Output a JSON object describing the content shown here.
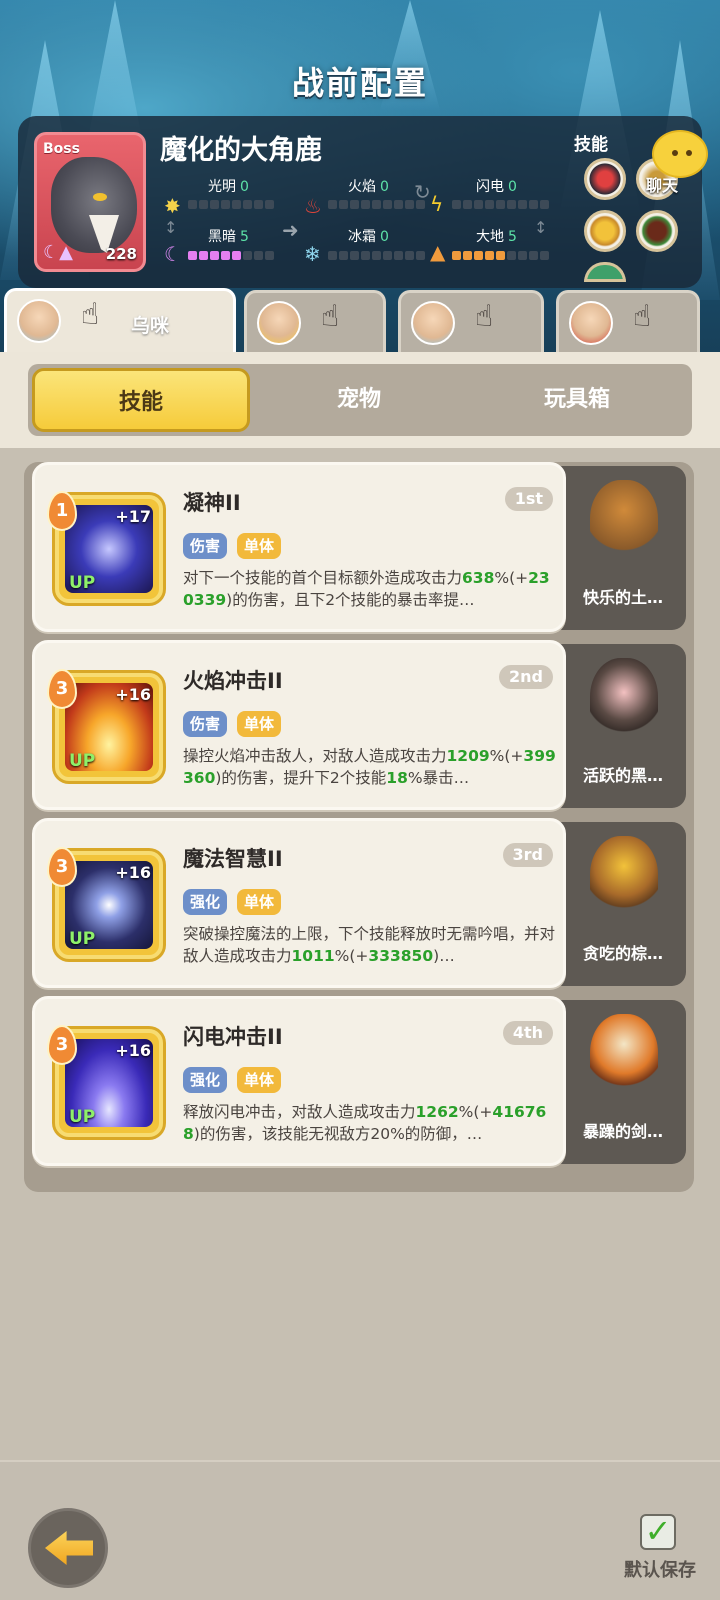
{
  "header": {
    "title": "战前配置"
  },
  "boss": {
    "tag": "Boss",
    "name": "魔化的大角鹿",
    "level": "228",
    "elements": [
      {
        "label": "光明",
        "value": "0"
      },
      {
        "label": "火焰",
        "value": "0"
      },
      {
        "label": "闪电",
        "value": "0"
      },
      {
        "label": "黑暗",
        "value": "5"
      },
      {
        "label": "冰霜",
        "value": "0"
      },
      {
        "label": "大地",
        "value": "5"
      }
    ],
    "skills_label": "技能"
  },
  "chat": {
    "label": "聊天"
  },
  "hero_tabs": [
    {
      "name": "乌咪",
      "active": true
    },
    {
      "name": "",
      "active": false
    },
    {
      "name": "",
      "active": false
    },
    {
      "name": "",
      "active": false
    }
  ],
  "segment_tabs": [
    "技能",
    "宠物",
    "玩具箱"
  ],
  "skills": [
    {
      "cost": "1",
      "plus": "+17",
      "up": "UP",
      "title": "凝神II",
      "order": "1st",
      "tags": [
        "伤害",
        "单体"
      ],
      "desc_parts": [
        "对下一个技能的首个目标额外造成攻击力",
        "638",
        "%(+",
        "230339",
        ")的伤害，且下2个技能的暴击率提…"
      ],
      "pet_name": "快乐的土…"
    },
    {
      "cost": "3",
      "plus": "+16",
      "up": "UP",
      "title": "火焰冲击II",
      "order": "2nd",
      "tags": [
        "伤害",
        "单体"
      ],
      "desc_parts": [
        "操控火焰冲击敌人，对敌人造成攻击力",
        "1209",
        "%(+",
        "399360",
        ")的伤害，提升下2个技能",
        "18",
        "%暴击…"
      ],
      "pet_name": "活跃的黑…"
    },
    {
      "cost": "3",
      "plus": "+16",
      "up": "UP",
      "title": "魔法智慧II",
      "order": "3rd",
      "tags": [
        "强化",
        "单体"
      ],
      "desc_parts": [
        "突破操控魔法的上限，下个技能释放时无需吟唱，并对敌人造成攻击力",
        "1011",
        "%(+",
        "333850",
        ")…"
      ],
      "pet_name": "贪吃的棕…"
    },
    {
      "cost": "3",
      "plus": "+16",
      "up": "UP",
      "title": "闪电冲击II",
      "order": "4th",
      "tags": [
        "强化",
        "单体"
      ],
      "desc_parts": [
        "释放闪电冲击，对敌人造成攻击力",
        "1262",
        "%(+",
        "416768",
        ")的伤害，该技能无视敌方20%的防御，…"
      ],
      "pet_name": "暴躁的剑…"
    }
  ],
  "footer": {
    "save_label": "默认保存"
  },
  "colors": {
    "accent_gold": "#f6cb3a",
    "green_value": "#2aa02a",
    "tag_blue": "#6d8fc9",
    "tag_gold": "#f2b93b"
  }
}
